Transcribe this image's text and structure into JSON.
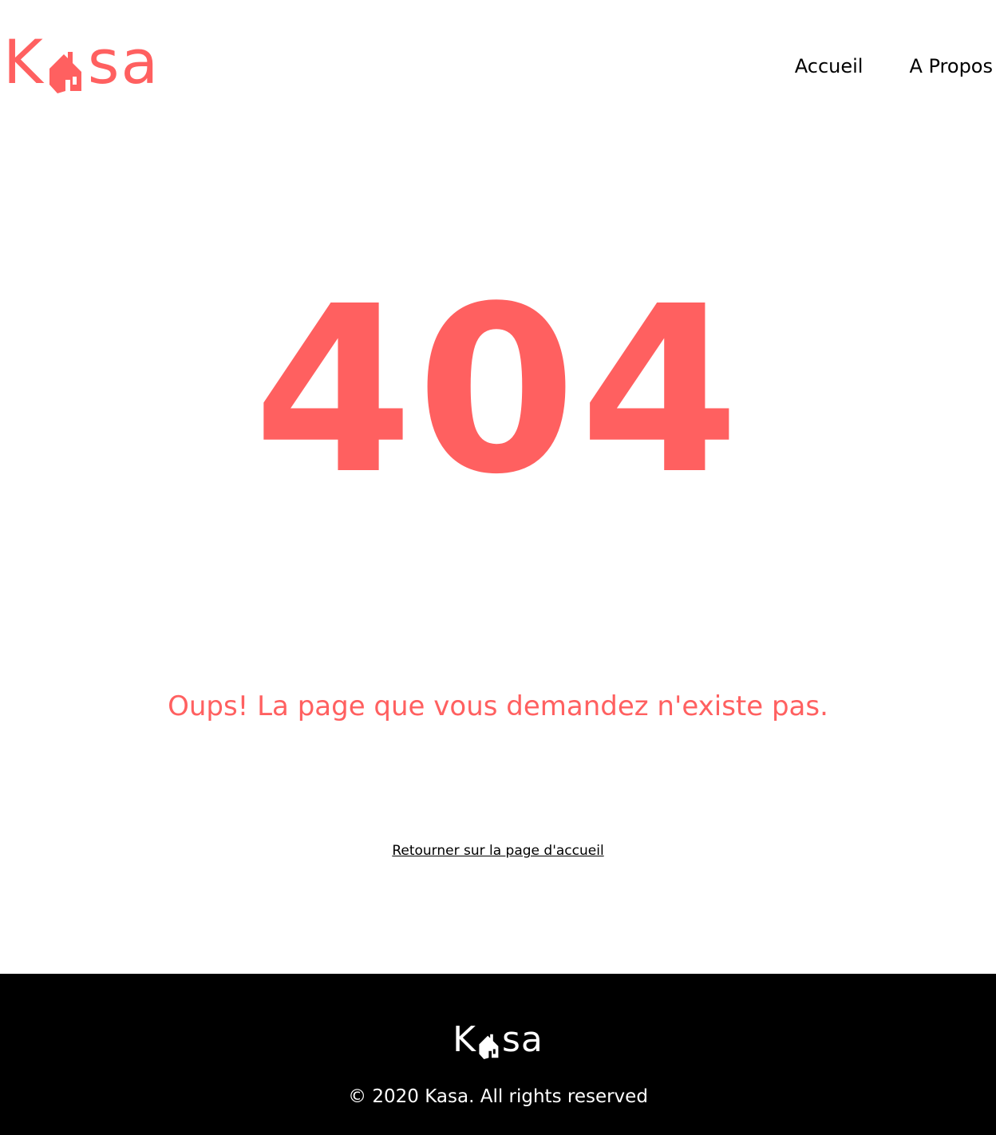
{
  "colors": {
    "brand": "#FF6060",
    "text": "#000000",
    "footer_bg": "#000000",
    "footer_text": "#FFFFFF",
    "background": "#FFFFFF"
  },
  "header": {
    "logo": {
      "letter_k": "K",
      "letters_sa": "sa",
      "icon": "house-icon"
    },
    "nav": [
      {
        "label": "Accueil"
      },
      {
        "label": "A Propos"
      }
    ]
  },
  "main": {
    "error_code": "404",
    "message": "Oups! La page que vous demandez n'existe pas.",
    "back_link": "Retourner sur la page d'accueil"
  },
  "footer": {
    "logo": {
      "letter_k": "K",
      "letters_sa": "sa",
      "icon": "house-icon"
    },
    "copyright": "© 2020 Kasa. All rights reserved"
  }
}
